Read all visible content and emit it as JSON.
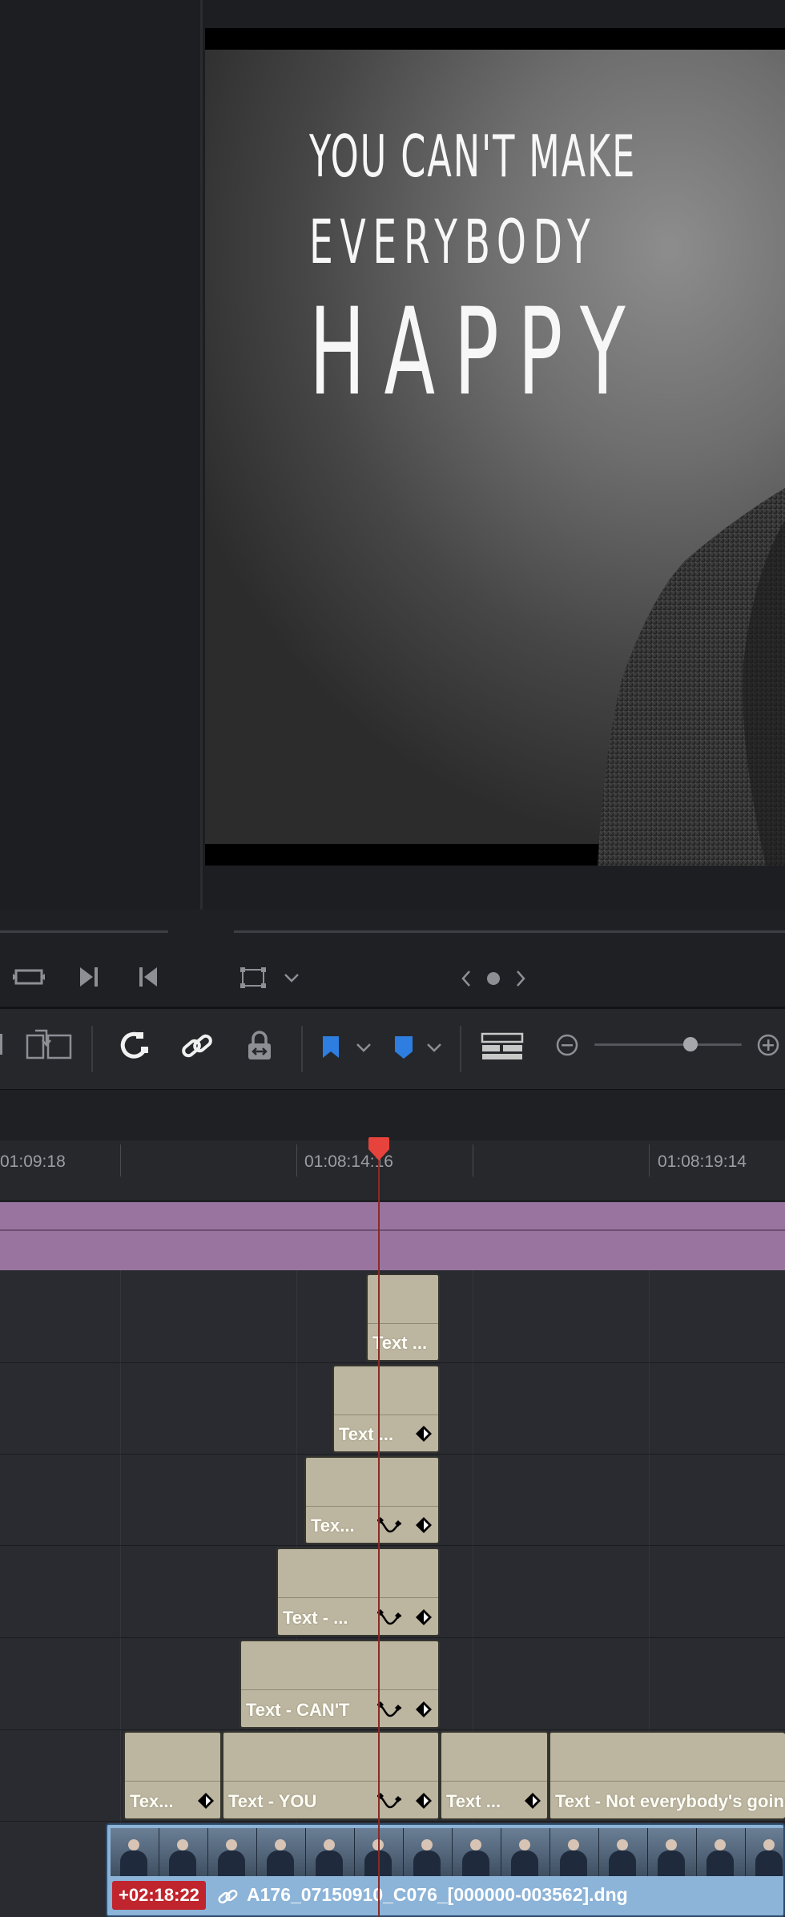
{
  "viewer": {
    "title_lines": [
      "YOU CAN'T MAKE",
      "EVERYBODY",
      "HAPPY"
    ]
  },
  "timeline": {
    "ruler_labels": [
      "01:09:18",
      "01:08:14:16",
      "01:08:19:14"
    ],
    "text_clips": [
      {
        "label": "Text ..."
      },
      {
        "label": "Text ..."
      },
      {
        "label": "Tex..."
      },
      {
        "label": "Text - ..."
      },
      {
        "label": "Text - CAN'T"
      },
      {
        "label": "Tex..."
      },
      {
        "label": "Text - YOU"
      },
      {
        "label": "Text ..."
      },
      {
        "label": "Text - Not everybody's going"
      }
    ],
    "video_clip": {
      "offset": "+02:18:22",
      "name": "A176_07150910_C076_[000000-003562].dng"
    }
  },
  "icons": [
    "loop-icon",
    "next-frame-icon",
    "previous-frame-icon",
    "transform-icon",
    "chevron-down-icon",
    "nav-left-icon",
    "nav-dot-icon",
    "nav-right-icon",
    "replace-icon",
    "snapping-icon",
    "link-icon",
    "lock-icon",
    "flag-icon",
    "marker-icon",
    "timeline-view-icon",
    "zoom-out-icon",
    "zoom-in-icon"
  ],
  "colors": {
    "playhead": "#e5433b",
    "subtitle_track": "#98749f",
    "text_clip": "#bcb59f",
    "video_clip": "#8cb3d8",
    "flag": "#2d7ee0",
    "offset_badge": "#c0242c"
  }
}
